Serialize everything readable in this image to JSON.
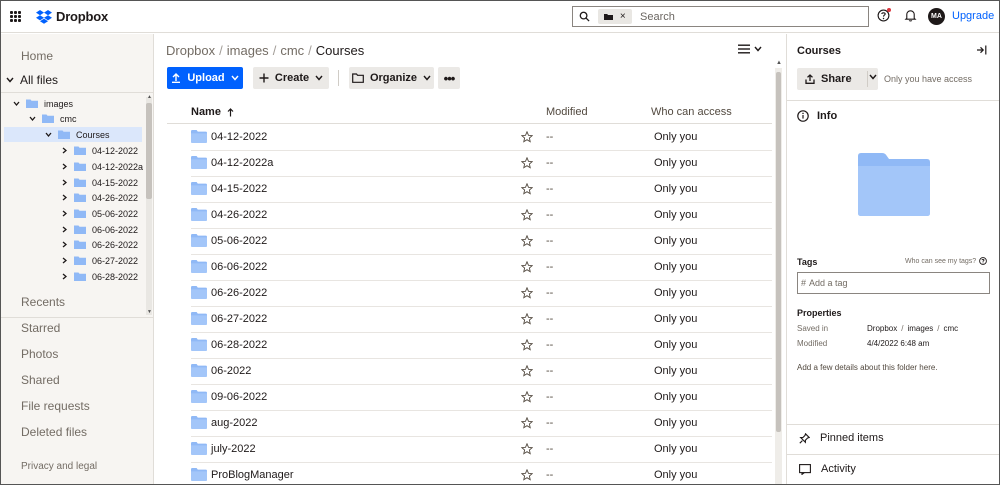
{
  "app": {
    "logo_text": "Dropbox"
  },
  "topbar": {
    "search_placeholder": "Search",
    "avatar_initials": "MA",
    "upgrade_label": "Upgrade"
  },
  "sidebar": {
    "home": "Home",
    "all_files": "All files",
    "tree": [
      {
        "label": "images",
        "level": 0,
        "expanded": true
      },
      {
        "label": "cmc",
        "level": 1,
        "expanded": true
      },
      {
        "label": "Courses",
        "level": 2,
        "expanded": true,
        "selected": true
      },
      {
        "label": "04-12-2022",
        "level": 3
      },
      {
        "label": "04-12-2022a",
        "level": 3
      },
      {
        "label": "04-15-2022",
        "level": 3
      },
      {
        "label": "04-26-2022",
        "level": 3
      },
      {
        "label": "05-06-2022",
        "level": 3
      },
      {
        "label": "06-06-2022",
        "level": 3
      },
      {
        "label": "06-26-2022",
        "level": 3
      },
      {
        "label": "06-27-2022",
        "level": 3
      },
      {
        "label": "06-28-2022",
        "level": 3
      }
    ],
    "links": [
      "Recents",
      "Starred",
      "Photos",
      "Shared",
      "File requests",
      "Deleted files"
    ],
    "privacy": "Privacy and legal"
  },
  "breadcrumb": {
    "parts": [
      "Dropbox",
      "images",
      "cmc"
    ],
    "current": "Courses",
    "separator": "/"
  },
  "toolbar": {
    "upload": "Upload",
    "create": "Create",
    "organize": "Organize",
    "more": "•••"
  },
  "table": {
    "headers": {
      "name": "Name",
      "modified": "Modified",
      "access": "Who can access"
    },
    "rows": [
      {
        "name": "04-12-2022",
        "modified": "--",
        "access": "Only you"
      },
      {
        "name": "04-12-2022a",
        "modified": "--",
        "access": "Only you"
      },
      {
        "name": "04-15-2022",
        "modified": "--",
        "access": "Only you"
      },
      {
        "name": "04-26-2022",
        "modified": "--",
        "access": "Only you"
      },
      {
        "name": "05-06-2022",
        "modified": "--",
        "access": "Only you"
      },
      {
        "name": "06-06-2022",
        "modified": "--",
        "access": "Only you"
      },
      {
        "name": "06-26-2022",
        "modified": "--",
        "access": "Only you"
      },
      {
        "name": "06-27-2022",
        "modified": "--",
        "access": "Only you"
      },
      {
        "name": "06-28-2022",
        "modified": "--",
        "access": "Only you"
      },
      {
        "name": "06-2022",
        "modified": "--",
        "access": "Only you"
      },
      {
        "name": "09-06-2022",
        "modified": "--",
        "access": "Only you"
      },
      {
        "name": "aug-2022",
        "modified": "--",
        "access": "Only you"
      },
      {
        "name": "july-2022",
        "modified": "--",
        "access": "Only you"
      },
      {
        "name": "ProBlogManager",
        "modified": "--",
        "access": "Only you"
      }
    ]
  },
  "panel": {
    "title": "Courses",
    "share_label": "Share",
    "share_note": "Only you have access",
    "info_label": "Info",
    "tags_label": "Tags",
    "tags_help": "Who can see my tags?",
    "tag_prefix": "#",
    "tag_placeholder": "Add a tag",
    "properties_label": "Properties",
    "saved_in_label": "Saved in",
    "saved_in_path": [
      "Dropbox",
      "images",
      "cmc"
    ],
    "modified_label": "Modified",
    "modified_value": "4/4/2022 6:48 am",
    "add_details": "Add a few details about this folder here.",
    "pinned": "Pinned items",
    "activity": "Activity"
  },
  "colors": {
    "accent": "#0061fe",
    "folder": "#90b9f6",
    "sidebar_bg": "#f7f5f2",
    "selected_bg": "#dbe7fb"
  }
}
